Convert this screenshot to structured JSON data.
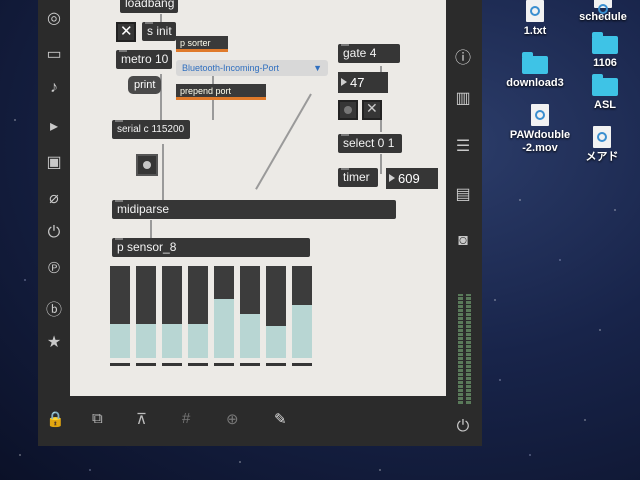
{
  "desktop": {
    "icons": [
      {
        "label": "1.txt",
        "type": "doc"
      },
      {
        "label": "schedule",
        "type": "folder"
      },
      {
        "label": "1106",
        "type": "folder"
      },
      {
        "label": "download3",
        "type": "folder"
      },
      {
        "label": "ASL",
        "type": "folder"
      },
      {
        "label": "PAWdouble",
        "label2": "-2.mov",
        "type": "doc"
      },
      {
        "label": "メアド",
        "type": "doc"
      }
    ]
  },
  "patch": {
    "loadbang": "loadbang",
    "sinit": "s init",
    "metro": "metro 10",
    "print": "print",
    "psorter": "p sorter",
    "port_menu": "Bluetooth-Incoming-Port",
    "prepend": "prepend port",
    "serial": "serial c 115200",
    "gate": "gate 4",
    "num47": "47",
    "select": "select 0 1",
    "timer": "timer",
    "num609": "609",
    "midiparse": "midiparse",
    "sensor": "p sensor_8",
    "slider_levels": [
      0.63,
      0.63,
      0.63,
      0.63,
      0.36,
      0.52,
      0.65,
      0.42
    ]
  },
  "colors": {
    "accent": "#e07a2a",
    "canvas": "#eceae6",
    "object": "#363636",
    "slider": "#b8d6d3"
  }
}
